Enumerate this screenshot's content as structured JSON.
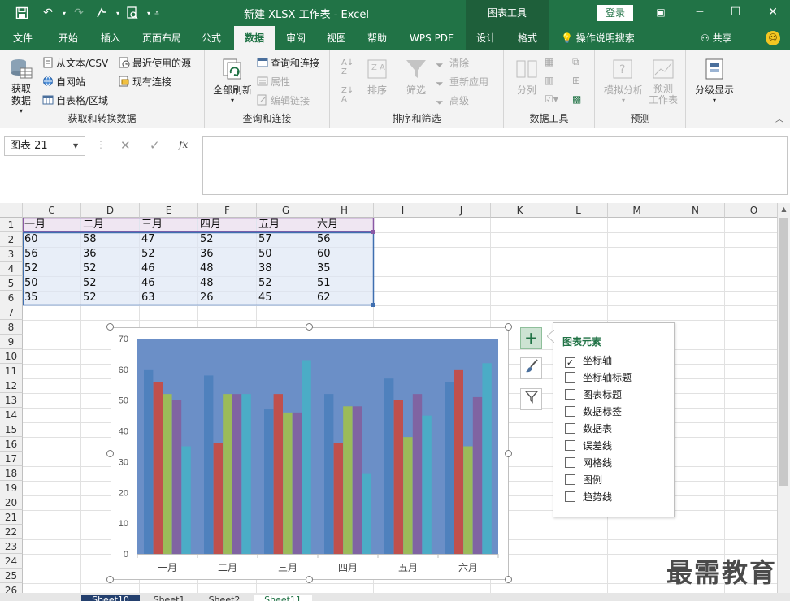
{
  "titlebar": {
    "title": "新建 XLSX 工作表  -  Excel",
    "chart_tools": "图表工具",
    "login": "登录"
  },
  "tabs": [
    {
      "label": "文件"
    },
    {
      "label": "开始"
    },
    {
      "label": "插入"
    },
    {
      "label": "页面布局"
    },
    {
      "label": "公式"
    },
    {
      "label": "数据"
    },
    {
      "label": "审阅"
    },
    {
      "label": "视图"
    },
    {
      "label": "帮助"
    },
    {
      "label": "WPS PDF"
    },
    {
      "label": "设计"
    },
    {
      "label": "格式"
    }
  ],
  "tell_me": "操作说明搜索",
  "share": "共享",
  "ribbon": {
    "get_data": "获取数据",
    "from_csv": "从文本/CSV",
    "from_web": "自网站",
    "from_table": "自表格/区域",
    "recent": "最近使用的源",
    "existing": "现有连接",
    "group1": "获取和转换数据",
    "refresh_all": "全部刷新",
    "queries": "查询和连接",
    "properties": "属性",
    "edit_links": "编辑链接",
    "group2": "查询和连接",
    "sort": "排序",
    "filter": "筛选",
    "clear": "清除",
    "reapply": "重新应用",
    "advanced": "高级",
    "group3": "排序和筛选",
    "split": "分列",
    "group4": "数据工具",
    "whatif": "模拟分析",
    "forecast": "预测",
    "forecast_sheet": "工作表",
    "group5": "预测",
    "outline": "分级显示"
  },
  "namebox": "图表 21",
  "columns": [
    "C",
    "D",
    "E",
    "F",
    "G",
    "H",
    "I",
    "J",
    "K",
    "L",
    "M",
    "N",
    "O"
  ],
  "rows": [
    "1",
    "2",
    "3",
    "4",
    "5",
    "6",
    "7",
    "8",
    "9",
    "10",
    "11",
    "12",
    "13",
    "14",
    "15",
    "16",
    "17",
    "18",
    "19",
    "20",
    "21",
    "22",
    "23",
    "24",
    "25",
    "26"
  ],
  "table": {
    "header": [
      "一月",
      "二月",
      "三月",
      "四月",
      "五月",
      "六月"
    ],
    "data": [
      [
        "60",
        "58",
        "47",
        "52",
        "57",
        "56"
      ],
      [
        "56",
        "36",
        "52",
        "36",
        "50",
        "60"
      ],
      [
        "52",
        "52",
        "46",
        "48",
        "38",
        "35"
      ],
      [
        "50",
        "52",
        "46",
        "48",
        "52",
        "51"
      ],
      [
        "35",
        "52",
        "63",
        "26",
        "45",
        "62"
      ]
    ]
  },
  "chart_data": {
    "type": "bar",
    "categories": [
      "一月",
      "二月",
      "三月",
      "四月",
      "五月",
      "六月"
    ],
    "series": [
      {
        "values": [
          60,
          58,
          47,
          52,
          57,
          56
        ],
        "color": "#4f81bd"
      },
      {
        "values": [
          56,
          36,
          52,
          36,
          50,
          60
        ],
        "color": "#c0504d"
      },
      {
        "values": [
          52,
          52,
          46,
          48,
          38,
          35
        ],
        "color": "#9bbb59"
      },
      {
        "values": [
          50,
          52,
          46,
          48,
          52,
          51
        ],
        "color": "#8064a2"
      },
      {
        "values": [
          35,
          52,
          63,
          26,
          45,
          62
        ],
        "color": "#4bacc6"
      }
    ],
    "ylim": [
      0,
      70
    ],
    "yticks": [
      0,
      10,
      20,
      30,
      40,
      50,
      60,
      70
    ],
    "plot_bg": "#6b8fc7",
    "legend": "none",
    "grid": false
  },
  "elements_panel": {
    "title": "图表元素",
    "items": [
      {
        "label": "坐标轴",
        "checked": true
      },
      {
        "label": "坐标轴标题",
        "checked": false
      },
      {
        "label": "图表标题",
        "checked": false
      },
      {
        "label": "数据标签",
        "checked": false
      },
      {
        "label": "数据表",
        "checked": false
      },
      {
        "label": "误差线",
        "checked": false
      },
      {
        "label": "网格线",
        "checked": false
      },
      {
        "label": "图例",
        "checked": false
      },
      {
        "label": "趋势线",
        "checked": false
      }
    ]
  },
  "sheet_tabs": [
    "Sheet10",
    "Sheet1",
    "Sheet2",
    "Sheet11"
  ],
  "watermark": "最需教育",
  "colors": {
    "excel_green": "#217346",
    "dark_green": "#1e5f3a"
  }
}
